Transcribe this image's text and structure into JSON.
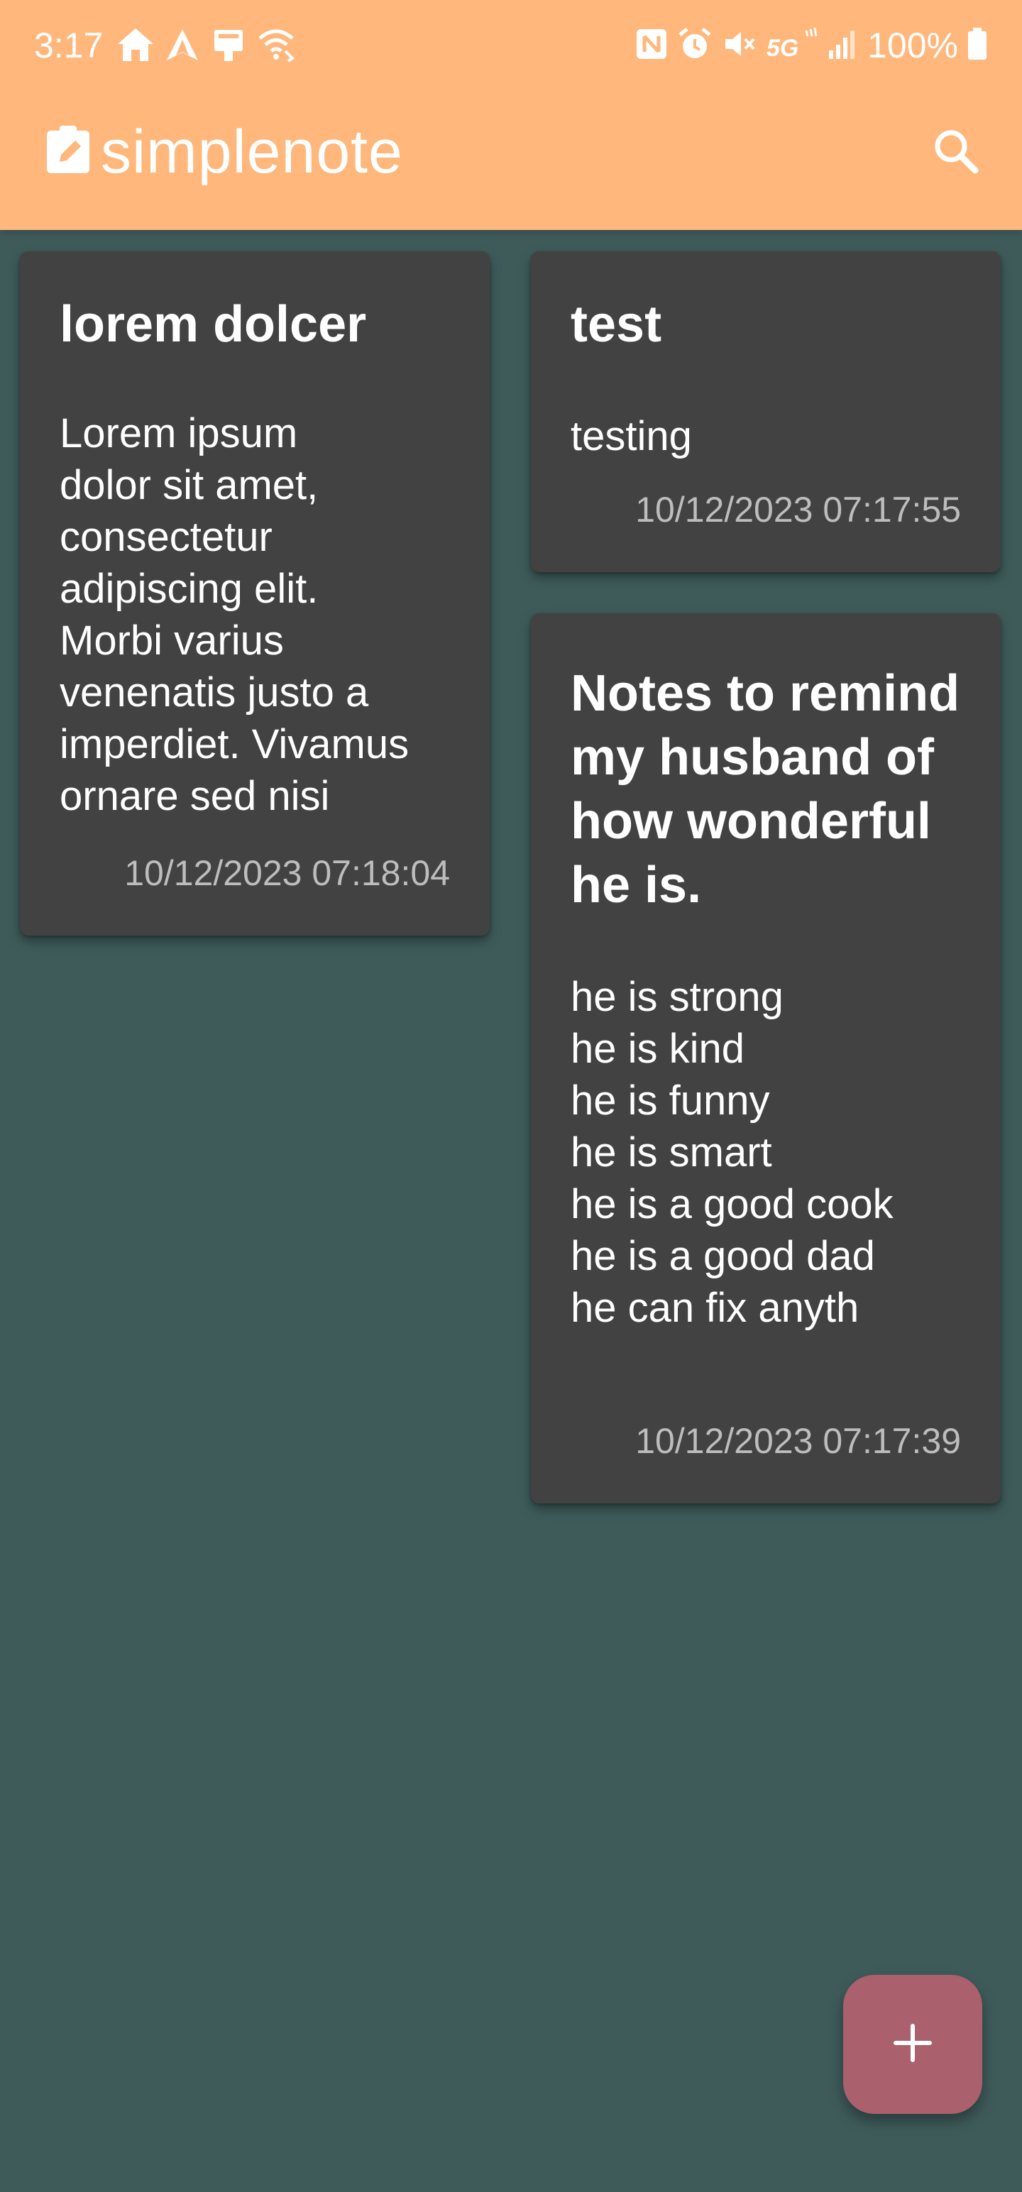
{
  "status_bar": {
    "time": "3:17",
    "battery": "100%",
    "left_icons": [
      "home-icon",
      "navigation-icon",
      "cast-icon",
      "wifi-calling-icon"
    ],
    "right_icons": [
      "nfc-icon",
      "alarm-icon",
      "mute-icon",
      "5g-icon",
      "signal-icon",
      "battery-icon"
    ]
  },
  "app_bar": {
    "title": "simplenote",
    "logo_icon": "note-edit-icon",
    "search_icon": "search-icon",
    "color": "#ffb77b"
  },
  "notes": [
    {
      "title": "lorem dolcer",
      "body": "Lorem ipsum\ndolor sit amet,\nconsectetur\nadipiscing elit.\nMorbi varius\nvenenatis justo a\nimperdiet. Vivamus\nornare sed nisi",
      "date": "10/12/2023 07:18:04"
    },
    {
      "title": "test",
      "body": "testing",
      "date": "10/12/2023 07:17:55"
    },
    {
      "title": "Notes to remind my husband of how wonderful he is.",
      "body": "he is strong\nhe is kind\nhe is funny\nhe is smart\nhe is a good cook\nhe is a good dad\nhe can fix anyth",
      "date": "10/12/2023 07:17:39"
    }
  ],
  "fab": {
    "icon": "plus-icon",
    "color": "#aa606d"
  },
  "colors": {
    "background": "#3e5b5a",
    "card": "#424242",
    "date_text": "#bdbdbd"
  }
}
